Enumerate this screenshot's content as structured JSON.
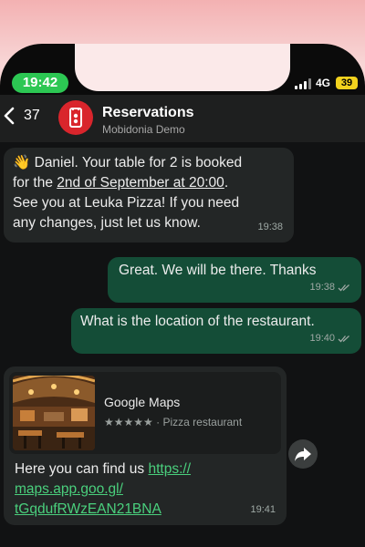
{
  "status": {
    "time": "19:42",
    "network": "4G",
    "battery": "39"
  },
  "header": {
    "back_count": "37",
    "contact_name": "Reservations",
    "contact_subtitle": "Mobidonia Demo"
  },
  "messages": [
    {
      "direction": "in",
      "emoji": "👋",
      "text_a": " Daniel. Your table for 2 is booked",
      "text_b": "for the ",
      "text_b_underlined": "2nd of September at 20:00",
      "text_b_end": ".",
      "text_c": "See you at Leuka Pizza! If you need",
      "text_d": "any changes, just let us know.",
      "time": "19:38"
    },
    {
      "direction": "out",
      "text": "Great. We will be there. Thanks",
      "time": "19:38"
    },
    {
      "direction": "out",
      "text": "What is the location of the restaurant.",
      "time": "19:40"
    },
    {
      "direction": "in",
      "preview": {
        "title": "Google Maps",
        "stars": "★★★★★",
        "category": "· Pizza restaurant"
      },
      "text": "Here you can find us ",
      "link_1": "https://",
      "link_2": "maps.app.goo.gl/",
      "link_3": "tGqdufRWzEAN21BNA",
      "time": "19:41"
    }
  ],
  "colors": {
    "incoming": "#232626",
    "outgoing": "#144d37",
    "link": "#4ad07d",
    "status_pill": "#2cc753"
  }
}
